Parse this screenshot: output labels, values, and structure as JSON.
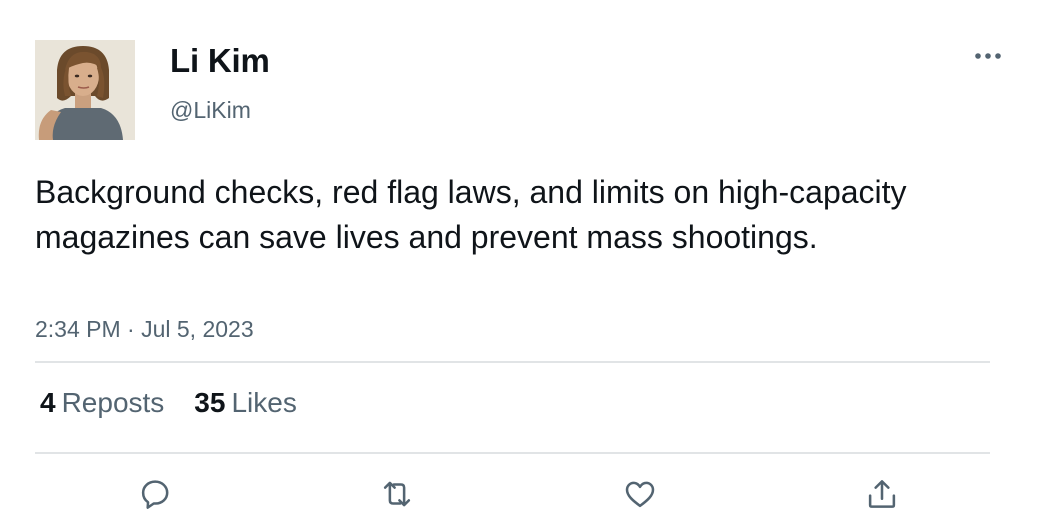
{
  "author": {
    "display_name": "Li Kim",
    "handle": "@LiKim"
  },
  "tweet": {
    "text": "Background checks, red flag laws, and limits on high-capacity magazines can save lives and prevent mass shootings.",
    "timestamp": "2:34 PM · Jul 5, 2023"
  },
  "stats": {
    "reposts_count": "4",
    "reposts_label": "Reposts",
    "likes_count": "35",
    "likes_label": "Likes"
  },
  "icons": {
    "more": "more-horizontal-icon",
    "reply": "reply-icon",
    "repost": "repost-icon",
    "like": "heart-icon",
    "share": "share-icon"
  },
  "colors": {
    "text_primary": "#0f1419",
    "text_secondary": "#536471",
    "divider": "#e1e4e6"
  }
}
